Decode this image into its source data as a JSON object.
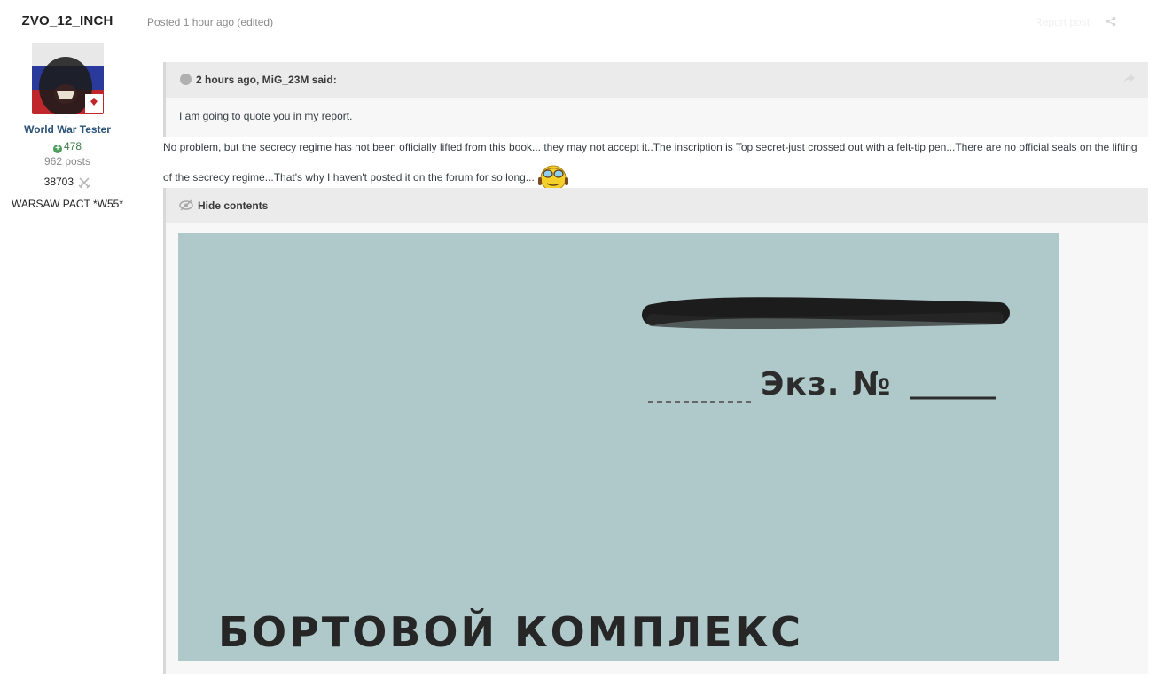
{
  "author": {
    "username": "ZVO_12_INCH",
    "title": "World War Tester",
    "reputation": "478",
    "posts": "962 posts",
    "points": "38703",
    "group": "WARSAW PACT *W55*"
  },
  "post": {
    "meta": "Posted 1 hour ago (edited)",
    "report": "Report post",
    "quote": {
      "citation": "2 hours ago, MiG_23M said:",
      "text": "I am going to quote you in my report."
    },
    "body": "No problem, but the secrecy regime has not been officially lifted from this book... they may not accept it..The inscription is Top secret-just crossed out with a felt-tip pen...There are no official seals on the lifting of the secrecy regime...That's why I haven't posted it on the forum for so long...",
    "spoiler": {
      "label": "Hide contents",
      "image_text": {
        "copy_no": "Экз. №",
        "title": "БОРТОВОЙ КОМПЛЕКС"
      }
    }
  },
  "colors": {
    "accent": "#2b5378",
    "reputation": "#3e7c4a",
    "quote_bg": "#ebebeb",
    "image_bg": "#afc8c9"
  }
}
